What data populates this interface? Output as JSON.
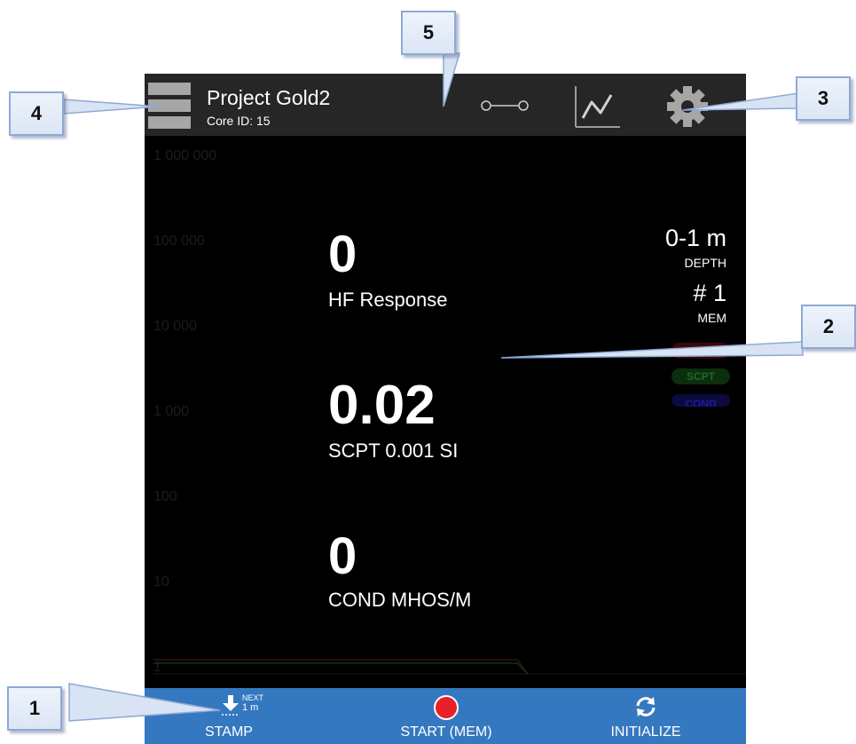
{
  "header": {
    "title": "Project Gold2",
    "subtitle": "Core ID: 15"
  },
  "plot": {
    "ticks": [
      "1 000 000",
      "100 000",
      "10 000",
      "1 000",
      "100",
      "10",
      "1"
    ]
  },
  "status": {
    "depth_value": "0-1 m",
    "depth_label": "DEPTH",
    "mem_value": "# 1",
    "mem_label": "MEM",
    "pills": [
      "HFR",
      "SCPT",
      "COND"
    ]
  },
  "readings": [
    {
      "value": "0",
      "label": "HF Response"
    },
    {
      "value": "0.02",
      "label": "SCPT 0.001 SI"
    },
    {
      "value": "0",
      "label": "COND MHOS/M"
    }
  ],
  "bottom": {
    "stamp_label": "STAMP",
    "stamp_next": "NEXT",
    "stamp_next_value": "1 m",
    "start_label": "START (MEM)",
    "init_label": "INITIALIZE"
  },
  "callouts": [
    "1",
    "2",
    "3",
    "4",
    "5"
  ],
  "colors": {
    "topbar": "#262626",
    "bottombar": "#3478c0",
    "record": "#e8202a",
    "hfr": "#7a1616",
    "scpt": "#1e6a25",
    "cond": "#1c1c9a"
  },
  "icons": [
    "menu-icon",
    "connection-icon",
    "graph-icon",
    "gear-icon",
    "download-icon",
    "record-icon",
    "refresh-icon"
  ]
}
